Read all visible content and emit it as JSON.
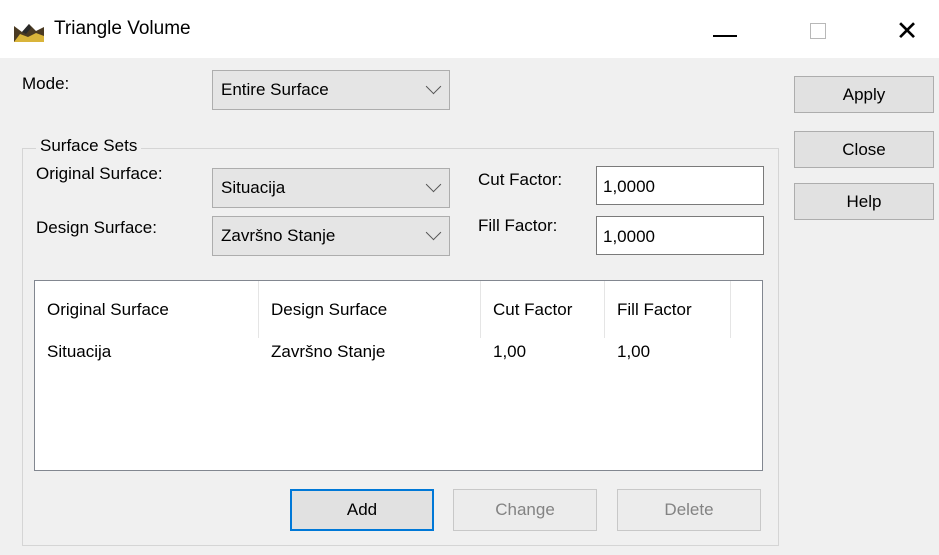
{
  "window": {
    "title": "Triangle Volume",
    "icon": "surface-terrain-icon",
    "controls": [
      "minimize-icon",
      "maximize-icon",
      "close-icon"
    ]
  },
  "mode": {
    "label": "Mode:",
    "value": "Entire Surface"
  },
  "side_buttons": {
    "apply": "Apply",
    "close": "Close",
    "help": "Help"
  },
  "surface_sets": {
    "legend": "Surface Sets",
    "original_label": "Original Surface:",
    "original_value": "Situacija",
    "design_label": "Design Surface:",
    "design_value": "Završno Stanje",
    "cut_label": "Cut Factor:",
    "cut_value": "1,0000",
    "fill_label": "Fill Factor:",
    "fill_value": "1,0000"
  },
  "list": {
    "columns": [
      "Original Surface",
      "Design Surface",
      "Cut Factor",
      "Fill Factor"
    ],
    "rows": [
      [
        "Situacija",
        "Završno Stanje",
        "1,00",
        "1,00"
      ]
    ]
  },
  "list_buttons": {
    "add": "Add",
    "change": "Change",
    "delete": "Delete"
  },
  "colors": {
    "default_button_border": "#0078d7",
    "disabled_text": "#838383"
  }
}
